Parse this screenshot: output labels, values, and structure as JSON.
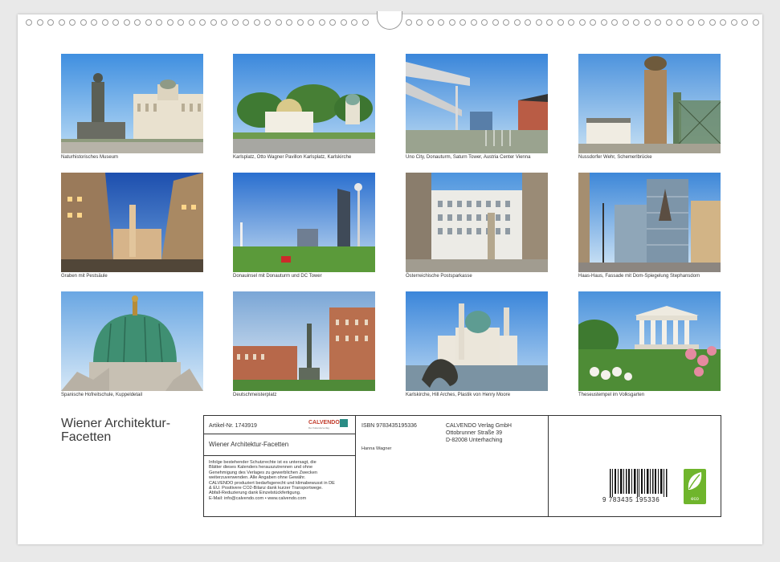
{
  "captions": [
    "Naturhistorisches Museum",
    "Karlsplatz, Otto Wagner Pavillon Karlsplatz, Karlskirche",
    "Uno City, Donauturm, Saturn Tower, Austria Center Vienna",
    "Nussdorfer Wehr, Schemerlbrücke",
    "Graben mit Pestsäule",
    "Donauinsel mit Donauturm und DC Tower",
    "Österreichische Postsparkasse",
    "Haas-Haus, Fassade mit Dom-Spiegelung Stephansdom",
    "Spanische Hofreitschule, Kuppeldetail",
    "Deutschmeisterplatz",
    "Karlskirche, Hill Arches, Plastik von Henry Moore",
    "Theseustempel im Volksgarten"
  ],
  "cover_title_line1": "Wiener Architektur-",
  "cover_title_line2": "Facetten",
  "info": {
    "article": "Artikel-Nr. 1743919",
    "brand": "CALVENDO",
    "brand_sub": "Der Kalenderverlag",
    "calendar_title": "Wiener Architektur-Facetten",
    "legal_lines": [
      "Infolge bestehender Schutzrechte ist es untersagt, die",
      "Blätter dieses Kalenders herauszutrennen und ohne",
      "Genehmigung des Verlages zu gewerblichen Zwecken",
      "weiterzuverwenden. Alle Angaben ohne Gewähr.",
      "CALVENDO produziert bedarfsgerecht und klimabewusst in DE",
      "& EU. Positivere CO2-Bilanz dank kurzer Transportwege.",
      "Abfall-Reduzierung dank Einzelstückfertigung.",
      "E-Mail: info@calvendo.com • www.calvendo.com"
    ],
    "isbn": "ISBN 9783435195336",
    "author": "Hanna Wagner",
    "publisher_lines": [
      "CALVENDO Verlag GmbH",
      "Ottobrunner Straße 39",
      "D-82008 Unterhaching"
    ],
    "barcode_digits": "9 783435 195336",
    "eco_label": "eco"
  }
}
